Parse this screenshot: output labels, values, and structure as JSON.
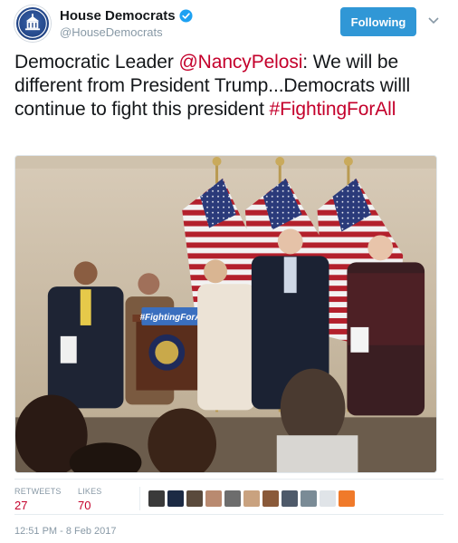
{
  "account": {
    "display_name": "House Democrats",
    "handle": "@HouseDemocrats",
    "verified": true,
    "avatar_icon": "house-democrats-logo-icon"
  },
  "follow_button": {
    "label": "Following"
  },
  "tweet": {
    "text_1": "Democratic Leader ",
    "mention": "@NancyPelosi",
    "text_2": ": We will be different from President Trump...Democrats willl continue to fight this president ",
    "hashtag": "#FightingForAll"
  },
  "photo": {
    "podium_sign": "#FightingForAll"
  },
  "stats": {
    "retweets_label": "RETWEETS",
    "retweets_value": "27",
    "likes_label": "LIKES",
    "likes_value": "70"
  },
  "likers": [
    {
      "name": "liker-avatar-1",
      "color": "#3a3a3a"
    },
    {
      "name": "liker-avatar-2",
      "color": "#1c2a44"
    },
    {
      "name": "liker-avatar-3",
      "color": "#5a4a3c"
    },
    {
      "name": "liker-avatar-4",
      "color": "#b98a70"
    },
    {
      "name": "liker-avatar-5",
      "color": "#6d6d6d"
    },
    {
      "name": "liker-avatar-6",
      "color": "#c9a27f"
    },
    {
      "name": "liker-avatar-7",
      "color": "#8a5a3a"
    },
    {
      "name": "liker-avatar-8",
      "color": "#4e5a6a"
    },
    {
      "name": "liker-avatar-9",
      "color": "#7a8b96"
    },
    {
      "name": "liker-avatar-10",
      "color": "#e0e4e8"
    },
    {
      "name": "liker-avatar-11",
      "color": "#f07a2a"
    }
  ],
  "timestamp": "12:51 PM - 8 Feb 2017",
  "colors": {
    "link": "#c4002b",
    "button": "#3097d6",
    "muted": "#8899a6"
  }
}
